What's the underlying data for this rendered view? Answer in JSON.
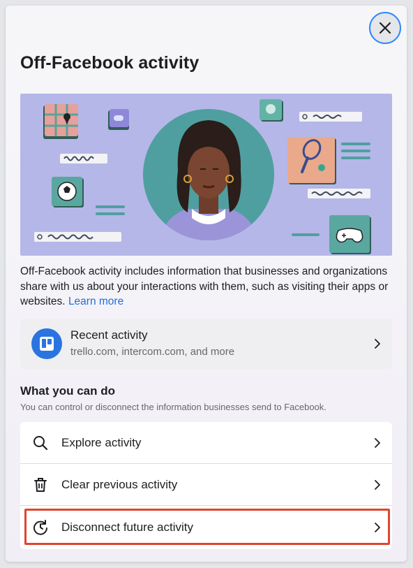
{
  "dialog": {
    "title": "Off-Facebook activity",
    "close_icon": "close-icon"
  },
  "description": {
    "text": "Off-Facebook activity includes information that businesses and organizations share with us about your interactions with them, such as visiting their apps or websites.",
    "link": "Learn more"
  },
  "recent": {
    "title": "Recent activity",
    "subtitle": "trello.com, intercom.com, and more",
    "icon": "trello-logo"
  },
  "section": {
    "title": "What you can do",
    "subtitle": "You can control or disconnect the information businesses send to Facebook."
  },
  "actions": [
    {
      "label": "Explore activity",
      "icon": "search-icon"
    },
    {
      "label": "Clear previous activity",
      "icon": "trash-icon"
    },
    {
      "label": "Disconnect future activity",
      "icon": "history-icon"
    }
  ],
  "colors": {
    "link": "#216fdb",
    "highlight": "#e0452d",
    "illustration_bg": "#b5b7e8",
    "trello_blue": "#2a74e0"
  }
}
